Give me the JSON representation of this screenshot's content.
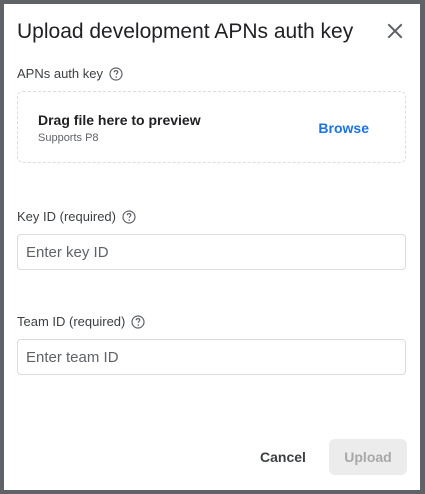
{
  "dialog": {
    "title": "Upload development APNs auth key"
  },
  "auth_key": {
    "label": "APNs auth key",
    "drop_title": "Drag file here to preview",
    "drop_subtitle": "Supports P8",
    "browse_label": "Browse"
  },
  "key_id": {
    "label": "Key ID (required)",
    "placeholder": "Enter key ID",
    "value": ""
  },
  "team_id": {
    "label": "Team ID (required)",
    "placeholder": "Enter team ID",
    "value": ""
  },
  "actions": {
    "cancel_label": "Cancel",
    "upload_label": "Upload",
    "upload_enabled": false
  },
  "colors": {
    "accent": "#1a73e8",
    "disabled_bg": "#ececec",
    "disabled_text": "#a8a8a8"
  },
  "icons": {
    "close": "close-icon",
    "help": "help-circle-icon"
  }
}
